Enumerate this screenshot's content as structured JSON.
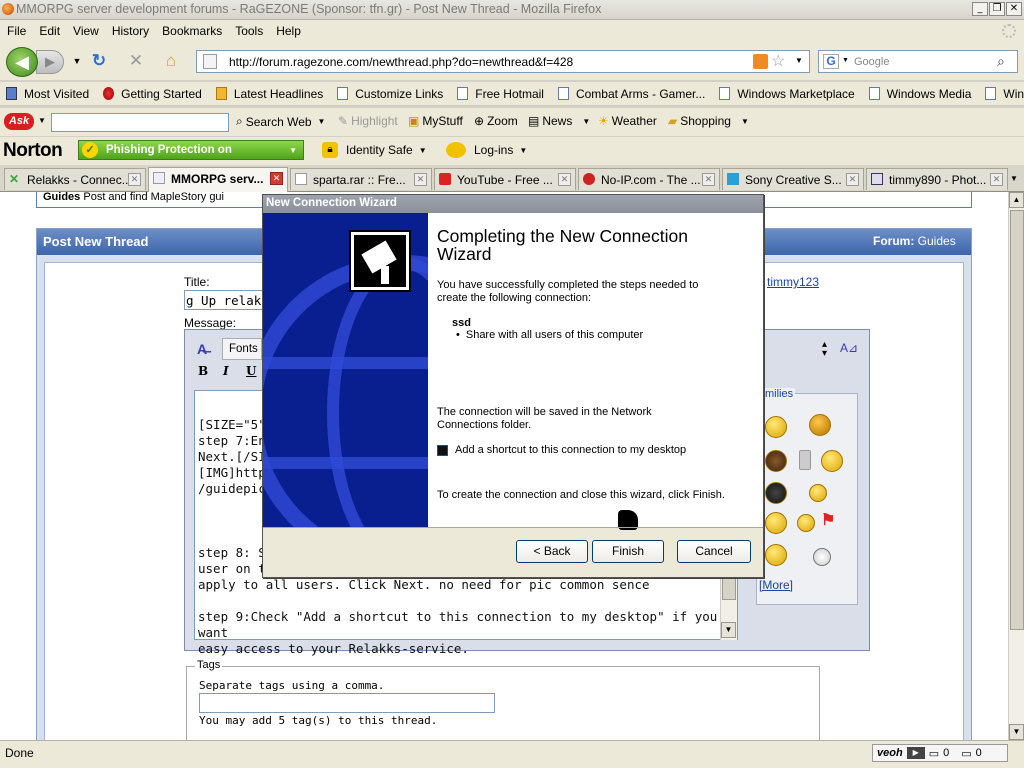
{
  "window": {
    "title": "MMORPG server development forums - RaGEZONE (Sponsor: tfn.gr) - Post New Thread - Mozilla Firefox"
  },
  "menu": [
    "File",
    "Edit",
    "View",
    "History",
    "Bookmarks",
    "Tools",
    "Help"
  ],
  "url": "http://forum.ragezone.com/newthread.php?do=newthread&f=428",
  "search_placeholder": "Google",
  "bookmarks": [
    "Most Visited",
    "Getting Started",
    "Latest Headlines",
    "Customize Links",
    "Free Hotmail",
    "Combat Arms - Gamer...",
    "Windows Marketplace",
    "Windows Media",
    "Windows"
  ],
  "ask_toolbar": {
    "search_web": "Search Web",
    "highlight": "Highlight",
    "mystuff": "MyStuff",
    "zoom": "Zoom",
    "news": "News",
    "weather": "Weather",
    "shopping": "Shopping"
  },
  "norton": {
    "brand": "Norton",
    "phishing": "Phishing Protection on",
    "identity": "Identity Safe",
    "login": "Log-ins"
  },
  "tabs": [
    "Relakks - Connec...",
    "MMORPG serv...",
    "sparta.rar :: Fre...",
    "YouTube - Free ...",
    "No-IP.com - The ...",
    "Sony Creative S...",
    "timmy890 - Phot..."
  ],
  "page": {
    "guides_title": "Guides",
    "guides_desc": "Post and find MapleStory gui",
    "post_header": "Post New Thread",
    "forum_label": "Forum:",
    "forum_name": "Guides",
    "title_label": "Title:",
    "title_value": "g Up relakks",
    "username": "timmy123",
    "message_label": "Message:",
    "fonts_label": "Fonts",
    "smilies_label": "milies",
    "more_link": "[More]",
    "message_lines": [
      "[SIZE=\"5\"",
      "step 7:En",
      "Next.[/SI",
      "[IMG]http",
      "/guidepic7",
      "",
      "",
      "",
      "step 8: S",
      "user on th",
      "apply to all users. Click Next. no need for pic common sence",
      "",
      "step 9:Check \"Add a shortcut to this connection to my desktop\" if you want",
      "easy access to your Relakks-service."
    ],
    "tags_legend": "Tags",
    "tags_hint": "Separate tags using a comma.",
    "tags_note": "You may add 5 tag(s) to this thread."
  },
  "wizard": {
    "title": "New Connection Wizard",
    "heading": "Completing the New Connection Wizard",
    "intro": "You have successfully completed the steps needed to create the following connection:",
    "conn_name": "ssd",
    "conn_detail": "Share with all users of this computer",
    "saved_note": "The connection will be saved in the Network Connections folder.",
    "shortcut_label": "Add a shortcut to this connection to my desktop",
    "shortcut_checked": true,
    "finish_note": "To create the connection and close this wizard, click Finish.",
    "back_btn": "< Back",
    "finish_btn": "Finish",
    "cancel_btn": "Cancel"
  },
  "status": {
    "text": "Done",
    "veoh": "veoh",
    "count1": "0",
    "count2": "0"
  }
}
